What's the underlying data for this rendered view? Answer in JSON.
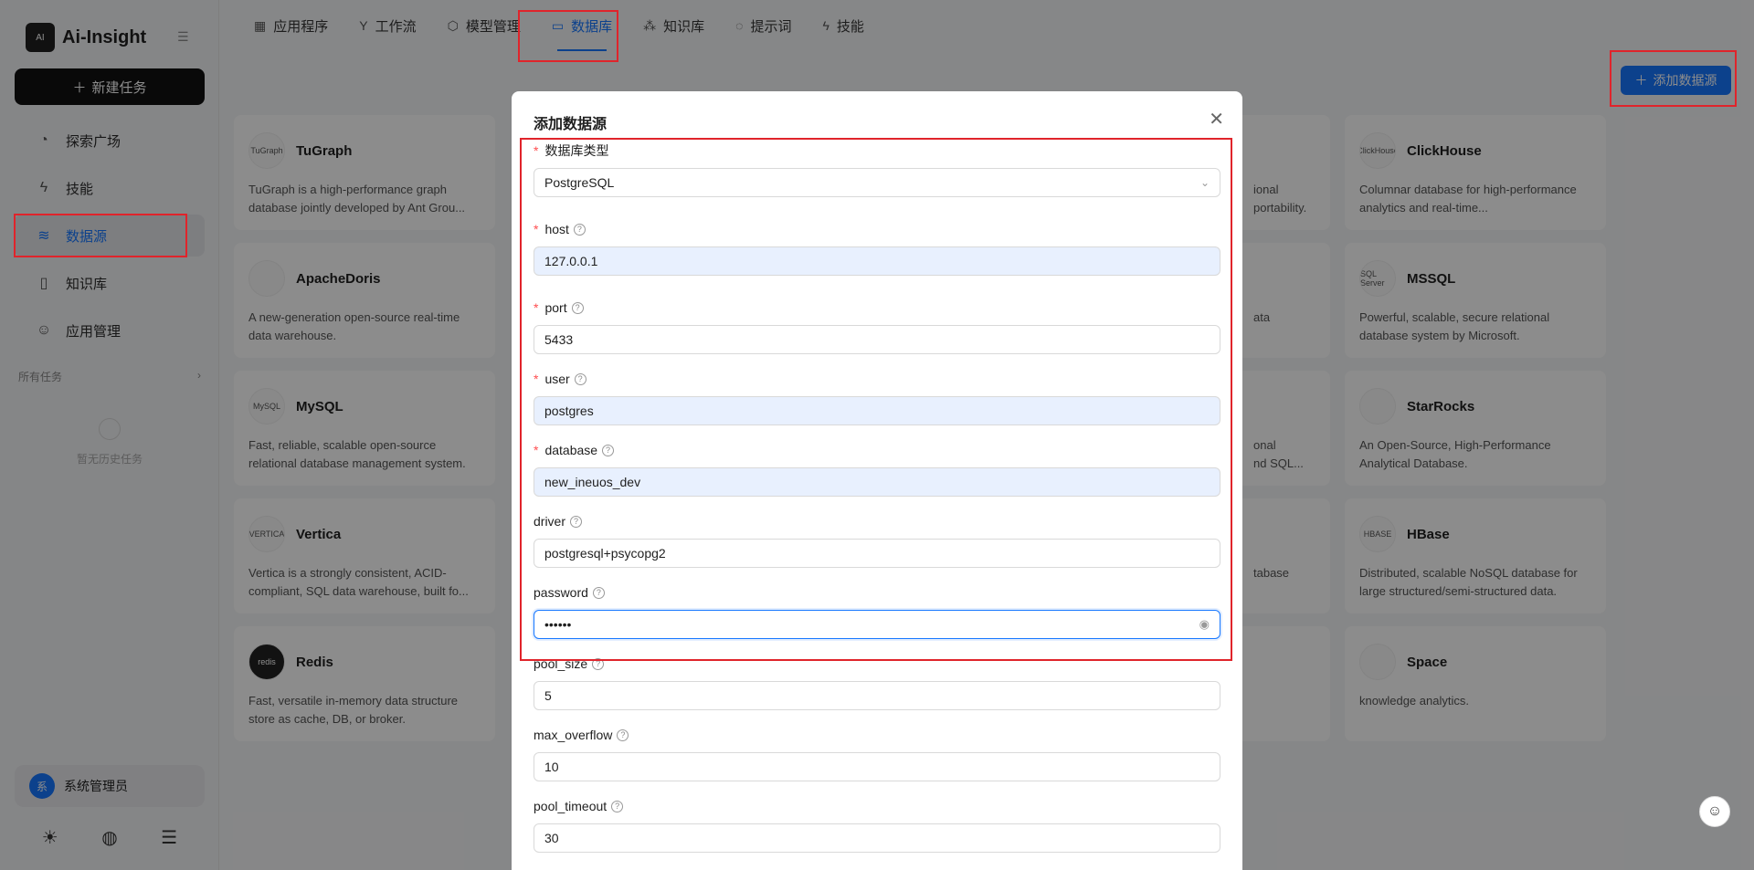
{
  "brand": {
    "name": "Ai-Insight",
    "logo_text": "AI"
  },
  "sidebar": {
    "new_task": "新建任务",
    "items": [
      {
        "label": "探索广场",
        "icon": "compass-icon"
      },
      {
        "label": "技能",
        "icon": "lightning-icon"
      },
      {
        "label": "数据源",
        "icon": "database-icon"
      },
      {
        "label": "知识库",
        "icon": "book-icon"
      },
      {
        "label": "应用管理",
        "icon": "robot-icon"
      }
    ],
    "section_all_tasks": "所有任务",
    "empty_history": "暂无历史任务",
    "user_initial": "系",
    "user_name": "系统管理员"
  },
  "topbar": {
    "tabs": [
      {
        "label": "应用程序"
      },
      {
        "label": "工作流"
      },
      {
        "label": "模型管理"
      },
      {
        "label": "数据库"
      },
      {
        "label": "知识库"
      },
      {
        "label": "提示词"
      },
      {
        "label": "技能"
      }
    ],
    "active_index": 3,
    "add_button": "添加数据源"
  },
  "cards": [
    {
      "name": "TuGraph",
      "logo": "TuGraph",
      "desc": "TuGraph is a high-performance graph database jointly developed by Ant Grou..."
    },
    {
      "name": "ClickHouse",
      "logo": "ClickHouse",
      "desc": "Columnar database for high-performance analytics and real-time..."
    },
    {
      "name": "ApacheDoris",
      "logo": "",
      "desc": "A new-generation open-source real-time data warehouse."
    },
    {
      "name": "MSSQL",
      "logo": "SQL Server",
      "desc": "Powerful, scalable, secure relational database system by Microsoft."
    },
    {
      "name": "MySQL",
      "logo": "MySQL",
      "desc": "Fast, reliable, scalable open-source relational database management system."
    },
    {
      "name": "StarRocks",
      "logo": "",
      "desc": "An Open-Source, High-Performance Analytical Database."
    },
    {
      "name": "Vertica",
      "logo": "VERTICA",
      "desc": "Vertica is a strongly consistent, ACID-compliant, SQL data warehouse, built fo..."
    },
    {
      "name": "HBase",
      "logo": "HBASE",
      "desc": "Distributed, scalable NoSQL database for large structured/semi-structured data."
    },
    {
      "name": "Redis",
      "logo": "redis",
      "desc": "Fast, versatile in-memory data structure store as cache, DB, or broker."
    },
    {
      "name": "Space",
      "logo": "",
      "desc": "knowledge analytics."
    }
  ],
  "partial_texts": [
    "ional",
    "portability.",
    "ata",
    "onal",
    "nd SQL...",
    "tabase"
  ],
  "modal": {
    "title": "添加数据源",
    "fields": [
      {
        "label": "数据库类型",
        "required": true,
        "help": false,
        "value": "PostgreSQL",
        "type": "select"
      },
      {
        "label": "host",
        "required": true,
        "help": true,
        "value": "127.0.0.1",
        "type": "filled"
      },
      {
        "label": "port",
        "required": true,
        "help": true,
        "value": "5433",
        "type": "text"
      },
      {
        "label": "user",
        "required": true,
        "help": true,
        "value": "postgres",
        "type": "filled"
      },
      {
        "label": "database",
        "required": true,
        "help": true,
        "value": "new_ineuos_dev",
        "type": "filled"
      },
      {
        "label": "driver",
        "required": false,
        "help": true,
        "value": "postgresql+psycopg2",
        "type": "text"
      },
      {
        "label": "password",
        "required": false,
        "help": true,
        "value": "••••••",
        "type": "password"
      },
      {
        "label": "pool_size",
        "required": false,
        "help": true,
        "value": "5",
        "type": "text"
      },
      {
        "label": "max_overflow",
        "required": false,
        "help": true,
        "value": "10",
        "type": "text"
      },
      {
        "label": "pool_timeout",
        "required": false,
        "help": true,
        "value": "30",
        "type": "text"
      }
    ]
  },
  "colors": {
    "accent": "#1677ff",
    "highlight": "#e0242b",
    "required": "#ff4d4f"
  }
}
